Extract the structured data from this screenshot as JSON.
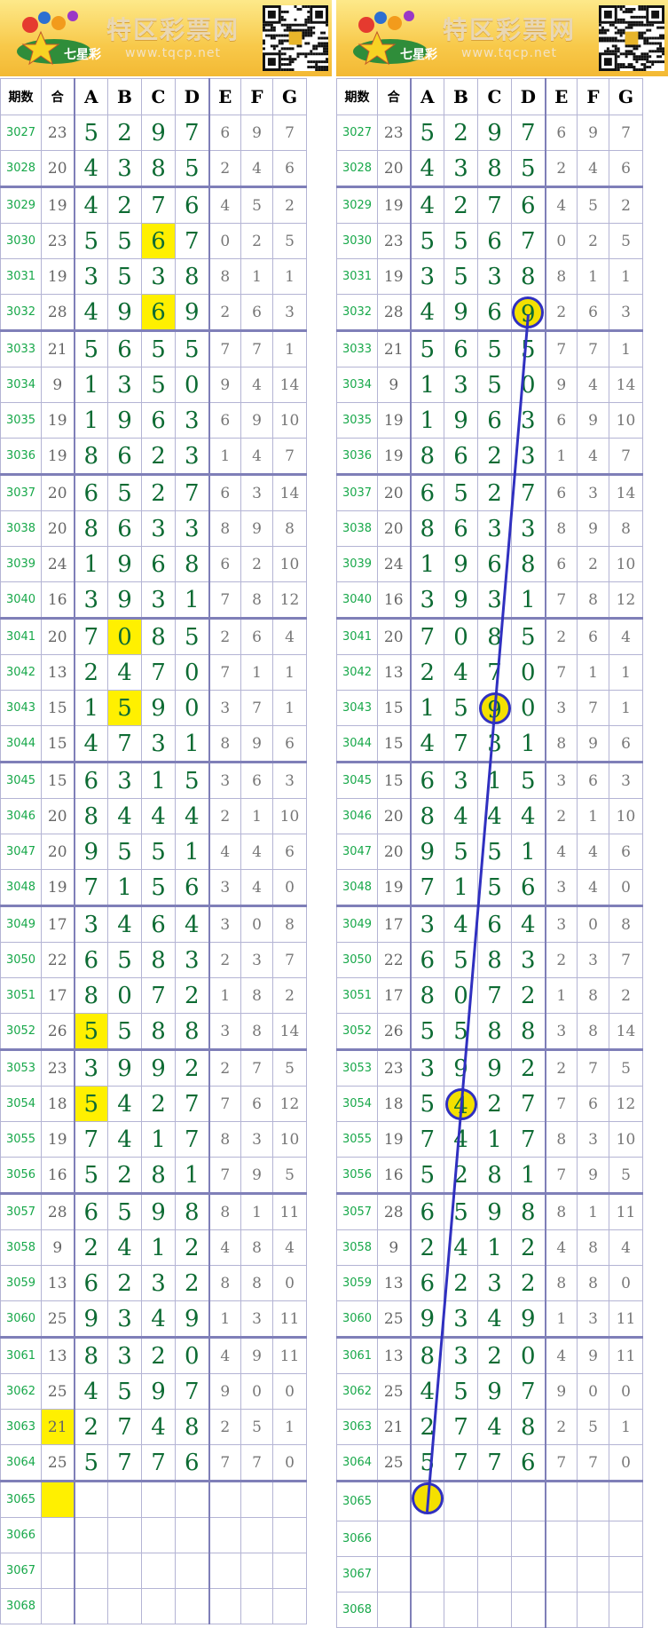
{
  "site": {
    "title": "特区彩票网",
    "url": "www.tqcp.net",
    "logo_text": "七星彩"
  },
  "headers": [
    "期数",
    "合",
    "A",
    "B",
    "C",
    "D",
    "E",
    "F",
    "G"
  ],
  "rows": [
    [
      "3027",
      "23",
      "5",
      "2",
      "9",
      "7",
      "6",
      "9",
      "7"
    ],
    [
      "3028",
      "20",
      "4",
      "3",
      "8",
      "5",
      "2",
      "4",
      "6"
    ],
    [
      "3029",
      "19",
      "4",
      "2",
      "7",
      "6",
      "4",
      "5",
      "2"
    ],
    [
      "3030",
      "23",
      "5",
      "5",
      "6",
      "7",
      "0",
      "2",
      "5"
    ],
    [
      "3031",
      "19",
      "3",
      "5",
      "3",
      "8",
      "8",
      "1",
      "1"
    ],
    [
      "3032",
      "28",
      "4",
      "9",
      "6",
      "9",
      "2",
      "6",
      "3"
    ],
    [
      "3033",
      "21",
      "5",
      "6",
      "5",
      "5",
      "7",
      "7",
      "1"
    ],
    [
      "3034",
      "9",
      "1",
      "3",
      "5",
      "0",
      "9",
      "4",
      "14"
    ],
    [
      "3035",
      "19",
      "1",
      "9",
      "6",
      "3",
      "6",
      "9",
      "10"
    ],
    [
      "3036",
      "19",
      "8",
      "6",
      "2",
      "3",
      "1",
      "4",
      "7"
    ],
    [
      "3037",
      "20",
      "6",
      "5",
      "2",
      "7",
      "6",
      "3",
      "14"
    ],
    [
      "3038",
      "20",
      "8",
      "6",
      "3",
      "3",
      "8",
      "9",
      "8"
    ],
    [
      "3039",
      "24",
      "1",
      "9",
      "6",
      "8",
      "6",
      "2",
      "10"
    ],
    [
      "3040",
      "16",
      "3",
      "9",
      "3",
      "1",
      "7",
      "8",
      "12"
    ],
    [
      "3041",
      "20",
      "7",
      "0",
      "8",
      "5",
      "2",
      "6",
      "4"
    ],
    [
      "3042",
      "13",
      "2",
      "4",
      "7",
      "0",
      "7",
      "1",
      "1"
    ],
    [
      "3043",
      "15",
      "1",
      "5",
      "9",
      "0",
      "3",
      "7",
      "1"
    ],
    [
      "3044",
      "15",
      "4",
      "7",
      "3",
      "1",
      "8",
      "9",
      "6"
    ],
    [
      "3045",
      "15",
      "6",
      "3",
      "1",
      "5",
      "3",
      "6",
      "3"
    ],
    [
      "3046",
      "20",
      "8",
      "4",
      "4",
      "4",
      "2",
      "1",
      "10"
    ],
    [
      "3047",
      "20",
      "9",
      "5",
      "5",
      "1",
      "4",
      "4",
      "6"
    ],
    [
      "3048",
      "19",
      "7",
      "1",
      "5",
      "6",
      "3",
      "4",
      "0"
    ],
    [
      "3049",
      "17",
      "3",
      "4",
      "6",
      "4",
      "3",
      "0",
      "8"
    ],
    [
      "3050",
      "22",
      "6",
      "5",
      "8",
      "3",
      "2",
      "3",
      "7"
    ],
    [
      "3051",
      "17",
      "8",
      "0",
      "7",
      "2",
      "1",
      "8",
      "2"
    ],
    [
      "3052",
      "26",
      "5",
      "5",
      "8",
      "8",
      "3",
      "8",
      "14"
    ],
    [
      "3053",
      "23",
      "3",
      "9",
      "9",
      "2",
      "2",
      "7",
      "5"
    ],
    [
      "3054",
      "18",
      "5",
      "4",
      "2",
      "7",
      "7",
      "6",
      "12"
    ],
    [
      "3055",
      "19",
      "7",
      "4",
      "1",
      "7",
      "8",
      "3",
      "10"
    ],
    [
      "3056",
      "16",
      "5",
      "2",
      "8",
      "1",
      "7",
      "9",
      "5"
    ],
    [
      "3057",
      "28",
      "6",
      "5",
      "9",
      "8",
      "8",
      "1",
      "11"
    ],
    [
      "3058",
      "9",
      "2",
      "4",
      "1",
      "2",
      "4",
      "8",
      "4"
    ],
    [
      "3059",
      "13",
      "6",
      "2",
      "3",
      "2",
      "8",
      "8",
      "0"
    ],
    [
      "3060",
      "25",
      "9",
      "3",
      "4",
      "9",
      "1",
      "3",
      "11"
    ],
    [
      "3061",
      "13",
      "8",
      "3",
      "2",
      "0",
      "4",
      "9",
      "11"
    ],
    [
      "3062",
      "25",
      "4",
      "5",
      "9",
      "7",
      "9",
      "0",
      "0"
    ],
    [
      "3063",
      "21",
      "2",
      "7",
      "4",
      "8",
      "2",
      "5",
      "1"
    ],
    [
      "3064",
      "25",
      "5",
      "7",
      "7",
      "6",
      "7",
      "7",
      "0"
    ],
    [
      "3065",
      "",
      "",
      "",
      "",
      "",
      "",
      "",
      ""
    ],
    [
      "3066",
      "",
      "",
      "",
      "",
      "",
      "",
      "",
      ""
    ],
    [
      "3067",
      "",
      "",
      "",
      "",
      "",
      "",
      "",
      ""
    ],
    [
      "3068",
      "",
      "",
      "",
      "",
      "",
      "",
      "",
      ""
    ]
  ],
  "left_highlights": [
    [
      3,
      4
    ],
    [
      5,
      4
    ],
    [
      14,
      3
    ],
    [
      16,
      3
    ],
    [
      25,
      2
    ],
    [
      27,
      2
    ],
    [
      36,
      1
    ],
    [
      38,
      1
    ]
  ],
  "right_rings": [
    [
      5,
      5
    ],
    [
      16,
      4
    ],
    [
      27,
      3
    ],
    [
      38,
      2
    ]
  ],
  "colors": {
    "highlight": "#fff000",
    "ring": "#3030c0",
    "issue": "#18a84a",
    "main_digit": "#0d6b33",
    "extra_digit": "#777777"
  }
}
